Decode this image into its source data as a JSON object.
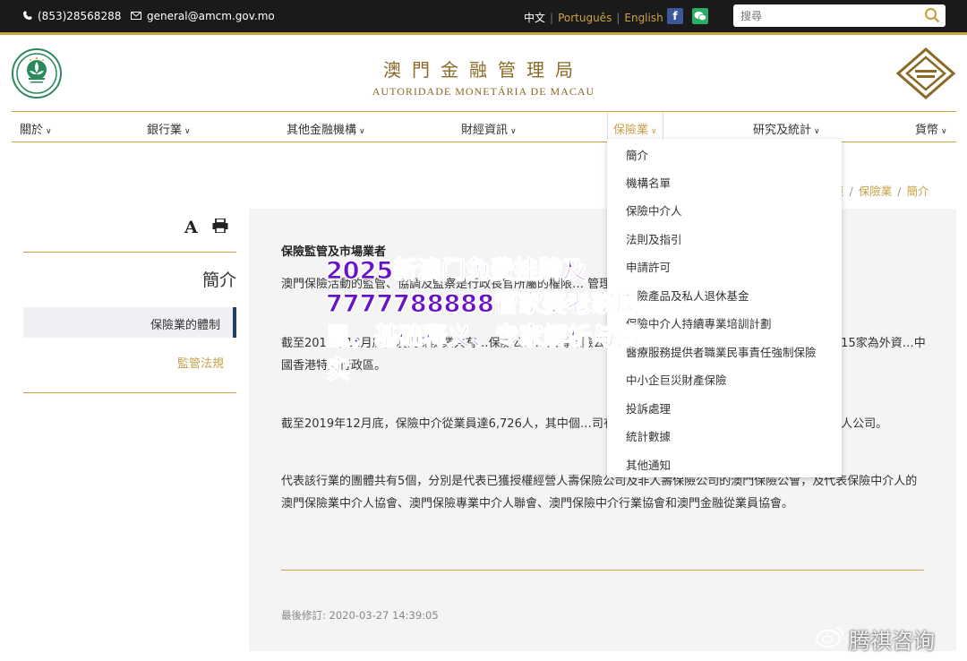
{
  "topbar": {
    "phone": "(853)28568288",
    "email": "general@amcm.gov.mo",
    "languages": [
      "中文",
      "Português",
      "English"
    ],
    "search_placeholder": "搜尋"
  },
  "header": {
    "title_cn": "澳門金融管理局",
    "title_pt": "AUTORIDADE MONETÁRIA DE MACAU"
  },
  "nav": {
    "items": [
      "關於",
      "銀行業",
      "其他金融機構",
      "財經資訊",
      "保險業",
      "研究及統計",
      "貨幣"
    ]
  },
  "dropdown": {
    "items": [
      "簡介",
      "機構名單",
      "保險中介人",
      "法則及指引",
      "申請許可",
      "保險產品及私人退休基金",
      "保險中介人持續專業培訓計劃",
      "醫療服務提供者職業民事責任強制保險",
      "中小企巨災財產保險",
      "投訴處理",
      "統計數據",
      "其他通知"
    ]
  },
  "breadcrumb": {
    "home": "頁",
    "section": "保險業",
    "current": "簡介"
  },
  "sidebar": {
    "title": "簡介",
    "items": [
      "保險業的體制",
      "監管法規"
    ]
  },
  "main": {
    "heading": "保險監管及市場業者",
    "p1": " 澳門保險活動的監管、協調及監察是行政長官所屬的權限… 管理局核下的保險監察範疇。",
    "p2": " 截至2019年12月底，澳門保險業共有…保險公司…人壽保險公司。據其原屬地區分，10家為本地公司及其餘15家為外資…中國香港特別行政區。",
    "p3": " 截至2019年12月底，保險中介從業員達6,726人，其中個…司有82家，1,560名保險推銷員及12名保險經紀人公司。",
    "p4": " 代表該行業的團體共有5個，分別是代表已獲授權經營人壽保險公司及非人壽保險公司的澳門保險公會，及代表保險中介人的澳門保險業中介人協會、澳門保險專業中介人聯會、澳門保險中介行業協會和澳門金融從業員協會。",
    "updated": "最後修訂: 2020-03-27 14:39:05"
  },
  "overlay": {
    "title": "2025新澳门免费挂牌及7777788888管家婆老家凤凰，基础释义、专家解析与落实",
    "watermark": "腾祺咨询"
  }
}
